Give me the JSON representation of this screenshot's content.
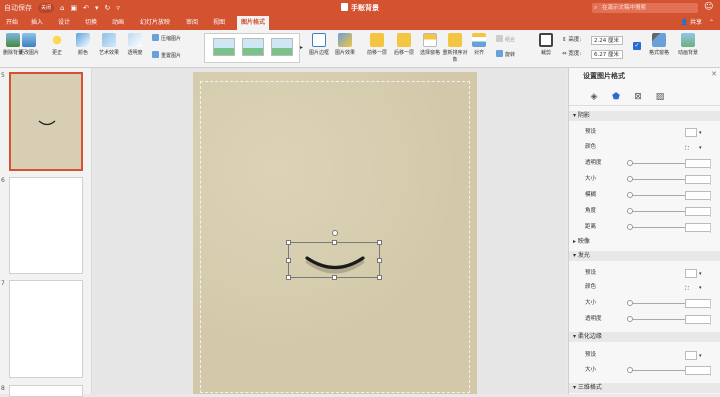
{
  "titlebar": {
    "autosave_label": "自动保存",
    "autosave_state": "关闭",
    "doc_title": "手账背景",
    "search_placeholder": "在演示文稿中搜索",
    "title_color": "#d35230"
  },
  "tabs": [
    {
      "label": "开始",
      "active": false
    },
    {
      "label": "插入",
      "active": false
    },
    {
      "label": "设计",
      "active": false
    },
    {
      "label": "切换",
      "active": false
    },
    {
      "label": "动画",
      "active": false
    },
    {
      "label": "幻灯片放映",
      "active": false
    },
    {
      "label": "审阅",
      "active": false
    },
    {
      "label": "视图",
      "active": false
    },
    {
      "label": "图片格式",
      "active": true
    }
  ],
  "share_label": "共享",
  "ribbon": {
    "remove_bg": "删除背景",
    "change_pic": "更改图片",
    "corrections": "更正",
    "color": "颜色",
    "artistic": "艺术效果",
    "transparency": "透明度",
    "compress": "压缩图片",
    "reset": "重置图片",
    "pic_border": "图片边框",
    "pic_effects": "图片效果",
    "bring_forward": "前移一层",
    "send_backward": "后移一层",
    "selection_pane": "选择窗格",
    "reorder": "重新排序对象",
    "align": "对齐",
    "group": "组合",
    "rotate": "旋转",
    "crop": "裁剪",
    "height_label": "高度:",
    "height_value": "2.24 厘米",
    "width_label": "宽度:",
    "width_value": "6.27 厘米",
    "format_pane": "格式窗格",
    "animation_bg": "动画背景"
  },
  "slides": [
    {
      "num": "5",
      "selected": true
    },
    {
      "num": "6",
      "selected": false
    },
    {
      "num": "7",
      "selected": false
    },
    {
      "num": "8",
      "selected": false
    }
  ],
  "format_pane": {
    "title": "设置图片格式",
    "tab_icons": [
      "fill-line-icon",
      "effects-icon",
      "size-properties-icon",
      "picture-icon"
    ],
    "sections": {
      "shadow": "阴影",
      "reflection": "映像",
      "glow": "发光",
      "soft_edges": "柔化边缘",
      "threed": "三维格式"
    },
    "labels": {
      "preset": "预设",
      "color": "颜色",
      "transparency": "透明度",
      "size": "大小",
      "blur": "模糊",
      "angle": "角度",
      "distance": "距离"
    }
  },
  "colors": {
    "accent": "#d35230",
    "slide_paper": "#d6cdb0",
    "active_tab_icon": "#2a6ad3"
  }
}
